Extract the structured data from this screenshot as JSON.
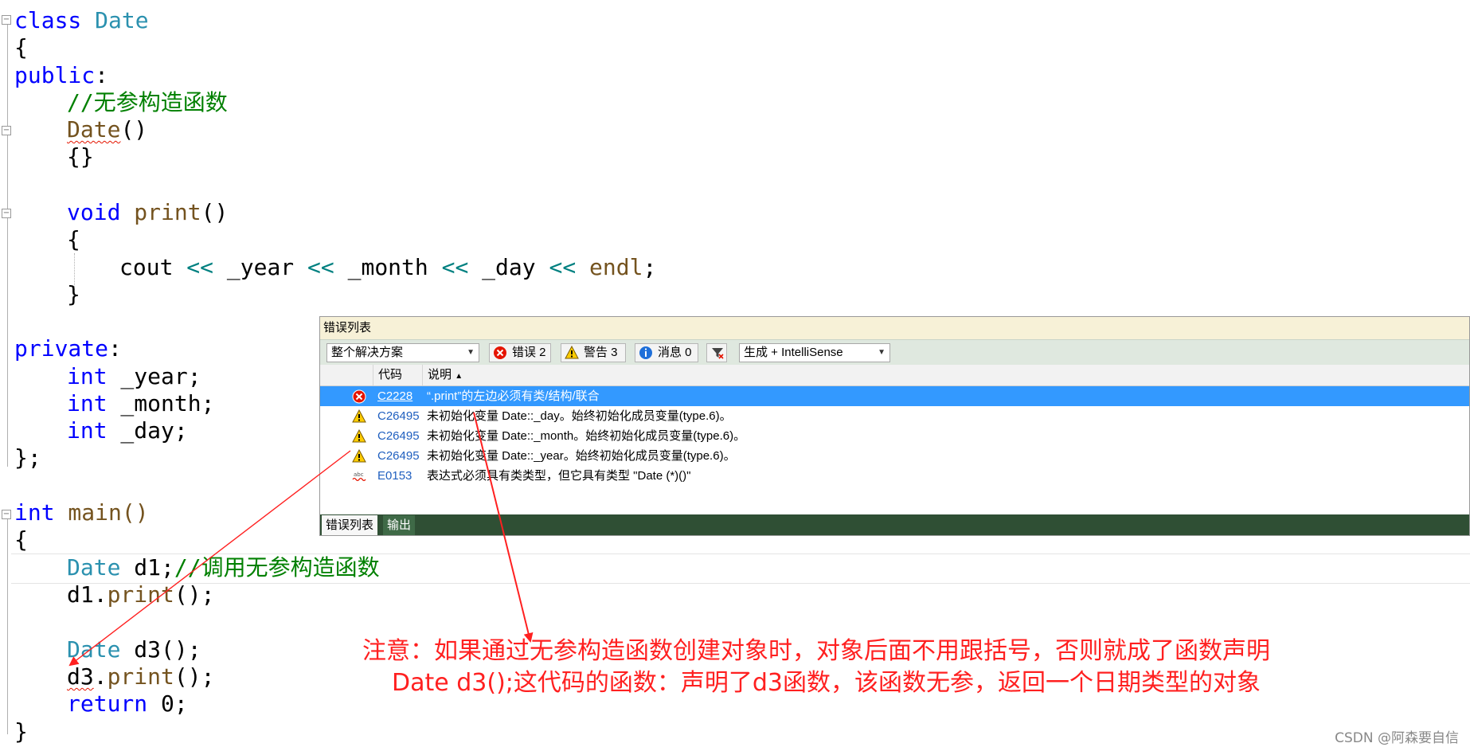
{
  "code": {
    "lines": [
      [
        "class ",
        "Date"
      ],
      [
        "{"
      ],
      [
        "public",
        ":"
      ],
      [
        "//无参构造函数"
      ],
      [
        "Date",
        "()"
      ],
      [
        "{}"
      ],
      [],
      [
        "void ",
        "print",
        "()"
      ],
      [
        "{"
      ],
      [
        "cout ",
        "<<",
        " _year ",
        "<<",
        " _month ",
        "<<",
        " _day ",
        "<<",
        " endl",
        ";"
      ],
      [
        "}"
      ],
      [],
      [
        "private",
        ":"
      ],
      [
        "int",
        " _year;"
      ],
      [
        "int",
        " _month;"
      ],
      [
        "int",
        " _day;"
      ],
      [
        "};"
      ],
      [],
      [
        "int",
        " main()"
      ],
      [
        "{"
      ],
      [
        "Date",
        " d1;",
        "//调用无参构造函数"
      ],
      [
        "d1.",
        "print",
        "();"
      ],
      [],
      [
        "Date",
        " d3();"
      ],
      [
        "d3",
        ".",
        "print",
        "();"
      ],
      [
        "return",
        " 0;"
      ],
      [
        "}"
      ]
    ]
  },
  "error_list": {
    "title": "错误列表",
    "scope": "整个解决方案",
    "errors_btn": "错误 2",
    "warnings_btn": "警告 3",
    "messages_btn": "消息 0",
    "build_filter": "生成 + IntelliSense",
    "col_code": "代码",
    "col_desc": "说明",
    "sort_arrow": "▲",
    "rows": [
      {
        "kind": "error",
        "code": "C2228",
        "desc": "“.print”的左边必须有类/结构/联合"
      },
      {
        "kind": "warning",
        "code": "C26495",
        "desc": "未初始化变量 Date::_day。始终初始化成员变量(type.6)。"
      },
      {
        "kind": "warning",
        "code": "C26495",
        "desc": "未初始化变量 Date::_month。始终初始化成员变量(type.6)。"
      },
      {
        "kind": "warning",
        "code": "C26495",
        "desc": "未初始化变量 Date::_year。始终初始化成员变量(type.6)。"
      },
      {
        "kind": "intellisense",
        "code": "E0153",
        "desc": "表达式必须具有类类型，但它具有类型 \"Date (*)()\""
      }
    ],
    "tab_errors": "错误列表",
    "tab_output": "输出"
  },
  "annotation": {
    "line1": "注意：如果通过无参构造函数创建对象时，对象后面不用跟括号，否则就成了函数声明",
    "line2": "Date d3();这代码的函数：声明了d3函数，该函数无参，返回一个日期类型的对象",
    "color": "#ff2020"
  },
  "watermark": "CSDN @阿森要自信",
  "icons": {
    "error": "error-circle-icon",
    "warning": "warning-triangle-icon",
    "info": "info-circle-icon",
    "filter": "filter-icon",
    "intellisense": "spellcheck-squiggle-icon"
  }
}
